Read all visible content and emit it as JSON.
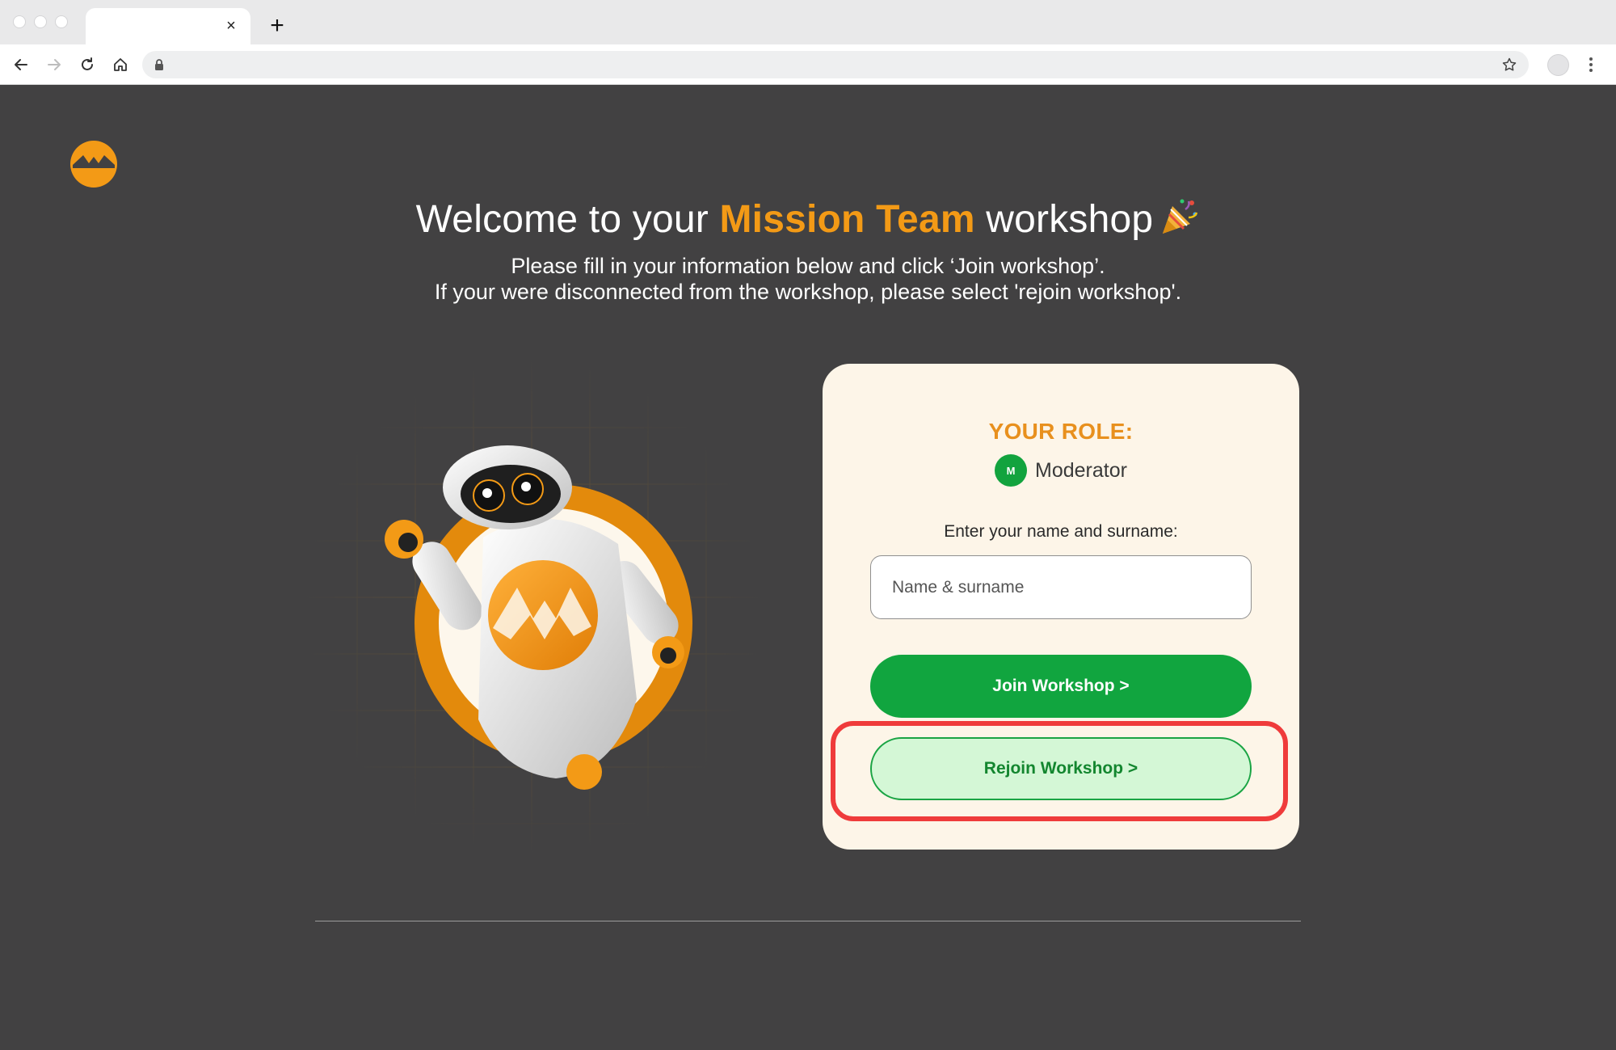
{
  "browser": {
    "tab_close_glyph": "×",
    "new_tab_glyph": "+",
    "icons": [
      "back-arrow-icon",
      "forward-arrow-icon",
      "reload-icon",
      "home-icon",
      "lock-icon",
      "star-icon",
      "kebab-menu-icon"
    ]
  },
  "hero": {
    "title_pre": "Welcome to your ",
    "title_accent": "Mission Team",
    "title_post": " workshop",
    "subtitle_line1": "Please fill in your information below and click ‘Join workshop’.",
    "subtitle_line2": "If your were disconnected from the workshop, please select 'rejoin workshop'."
  },
  "card": {
    "role_title": "YOUR ROLE:",
    "role_initial": "M",
    "role_name": "Moderator",
    "name_label": "Enter your name and surname:",
    "name_placeholder": "Name & surname",
    "join_label": "Join Workshop >",
    "rejoin_label": "Rejoin Workshop >"
  },
  "colors": {
    "page_bg": "#424142",
    "accent_orange": "#f39a16",
    "card_bg": "#fdf5e8",
    "green": "#11a53f",
    "rejoin_bg": "#d4f7d6",
    "highlight_red": "#ef3b3b"
  }
}
